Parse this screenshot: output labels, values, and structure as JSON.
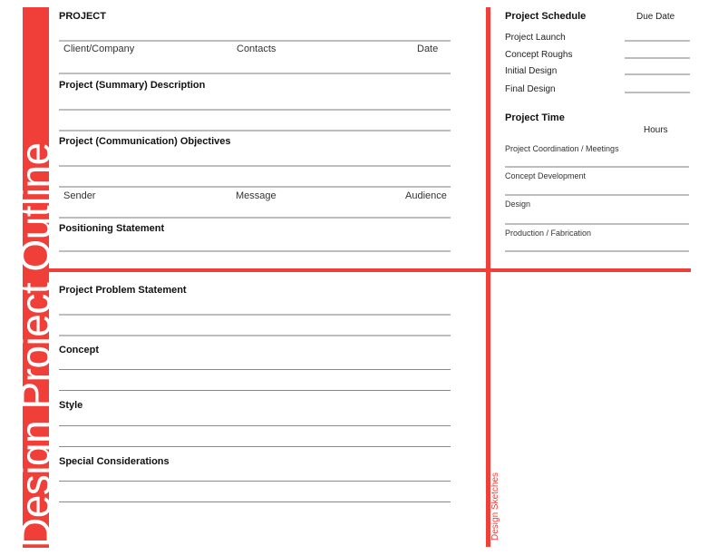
{
  "side_title": "Design Project Outline",
  "left": {
    "project_label": "PROJECT",
    "client_row": {
      "client": "Client/Company",
      "contacts": "Contacts",
      "date": "Date"
    },
    "summary_description": "Project (Summary) Description",
    "communication_objectives": "Project (Communication) Objectives",
    "smc_row": {
      "sender": "Sender",
      "message": "Message",
      "audience": "Audience"
    },
    "positioning_statement": "Positioning Statement",
    "problem_statement": "Project Problem Statement",
    "concept": "Concept",
    "style": "Style",
    "special_considerations": "Special Considerations"
  },
  "schedule": {
    "title": "Project Schedule",
    "due_date_header": "Due Date",
    "items": [
      "Project Launch",
      "Concept Roughs",
      "Initial Design",
      "Final Design"
    ]
  },
  "project_time": {
    "title": "Project Time",
    "hours_header": "Hours",
    "items": [
      "Project Coordination / Meetings",
      "Concept Development",
      "Design",
      "Production / Fabrication"
    ]
  },
  "sketches_label": "Design Sketches",
  "colors": {
    "accent": "#ef3f38",
    "rule": "#bdbdbd"
  }
}
